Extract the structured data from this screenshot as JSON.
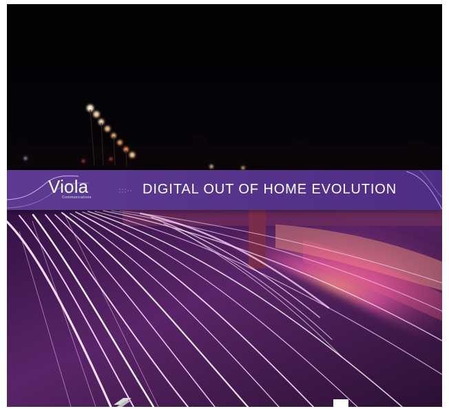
{
  "billboard": {
    "brand_name": "Viola",
    "brand_tagline": "Communications",
    "headline": "DIGITAL OUT OF HOME EVOLUTION"
  },
  "colors": {
    "sky": "#050309",
    "banner_start": "#5d3b92",
    "banner_end": "#4e2d86",
    "light_trail": "#f6d9f6",
    "road": "#4a1c58",
    "glow": "#ff8fd2"
  }
}
